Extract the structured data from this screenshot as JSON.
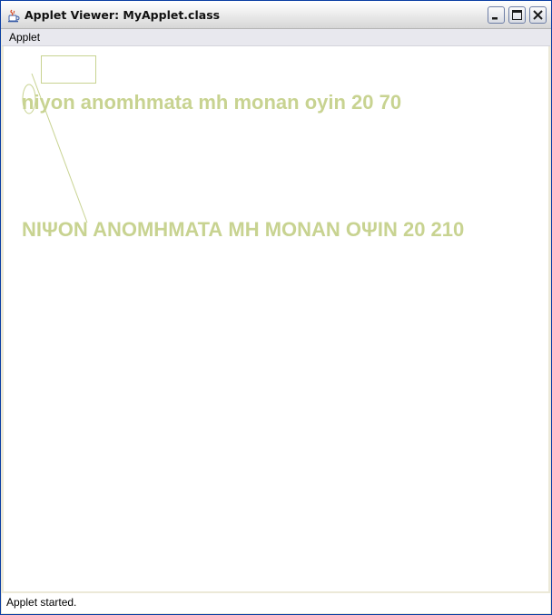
{
  "window": {
    "title": "Applet Viewer: MyApplet.class"
  },
  "menu": {
    "items": [
      "Applet"
    ]
  },
  "applet": {
    "draw_color": "#c8d391",
    "line1": "niyon anomhmata mh monan oyin 20 70",
    "line2": "ΝΙΨΟΝ ΑΝΟΜΗΜΑΤΑ ΜΗ ΜΟΝΑΝ ΟΨΙΝ 20 210"
  },
  "status": {
    "text": "Applet started."
  },
  "icons": {
    "app": "java-cup-icon",
    "minimize": "minimize-icon",
    "maximize": "maximize-icon",
    "close": "close-icon"
  }
}
